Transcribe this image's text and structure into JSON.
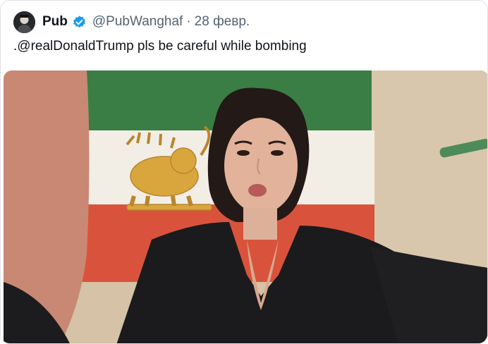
{
  "tweet": {
    "author": {
      "display_name": "Pub",
      "handle": "@PubWanghaf",
      "verified": true,
      "avatar_icon": "avatar-icon",
      "verified_icon": "verified-badge-icon"
    },
    "separator": "·",
    "date": "28 февр.",
    "text": ".@realDonaldTrump pls be careful while bombing",
    "media": {
      "type": "photo",
      "description_icon": "photo-icon"
    }
  },
  "colors": {
    "text_primary": "#0f1419",
    "text_secondary": "#536471",
    "verified_blue": "#1d9bf0",
    "flag_green": "#3a7d45",
    "flag_white": "#f2eee6",
    "flag_red": "#d9533c",
    "emblem_gold": "#d9a63e"
  }
}
